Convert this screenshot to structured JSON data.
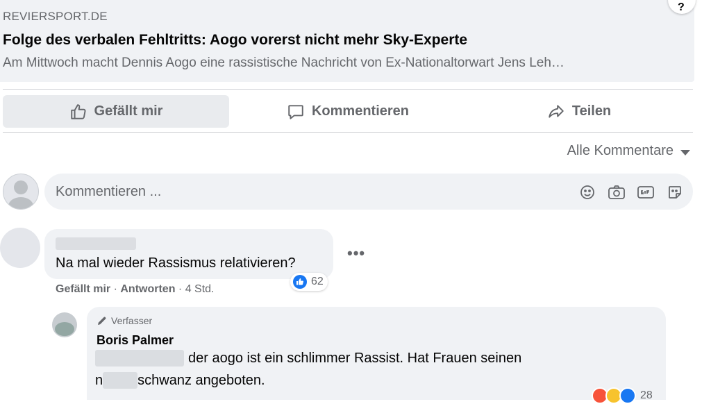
{
  "link_preview": {
    "domain": "REVIERSPORT.DE",
    "title": "Folge des verbalen Fehltritts: Aogo vorerst nicht mehr Sky-Experte",
    "description": "Am Mittwoch macht Dennis Aogo eine rassistische Nachricht von Ex-Nationaltorwart Jens Leh…",
    "corner_glyph": "?"
  },
  "actions": {
    "like_label": "Gefällt mir",
    "comment_label": "Kommentieren",
    "share_label": "Teilen"
  },
  "sort": {
    "label": "Alle Kommentare"
  },
  "composer": {
    "placeholder": "Kommentieren ...",
    "icons": [
      "emoji-icon",
      "camera-icon",
      "gif-icon",
      "sticker-icon"
    ]
  },
  "comments": [
    {
      "text": "Na mal wieder Rassismus relativieren?",
      "more": "•••",
      "reaction_count": "62",
      "like_action": "Gefällt mir",
      "separator1": " · ",
      "reply_action": "Antworten",
      "separator2": " · ",
      "time": "4 Std."
    }
  ],
  "reply": {
    "badge": "Verfasser",
    "author": "Boris Palmer",
    "line1": "der aogo ist ein schlimmer Rassist. Hat Frauen seinen",
    "line2_prefix": "n",
    "line2_suffix": "schwanz angeboten.",
    "reaction_count": "28"
  },
  "colors": {
    "accent": "#1877f2",
    "secondary_text": "#65676b",
    "bubble_bg": "#f0f2f5"
  }
}
